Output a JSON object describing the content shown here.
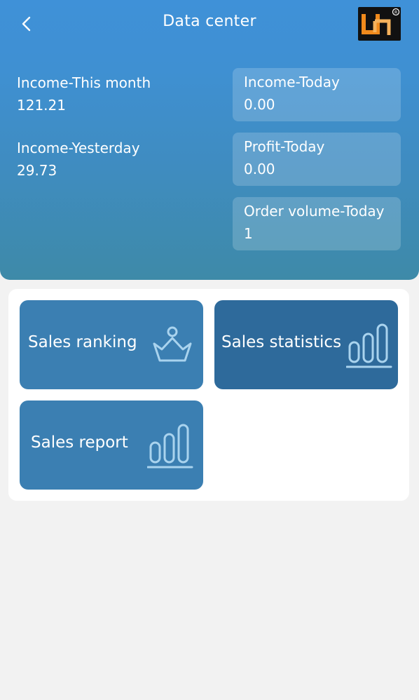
{
  "header": {
    "title": "Data center"
  },
  "stats": {
    "income_month": {
      "label": "Income-This month",
      "value": "121.21"
    },
    "income_yesterday": {
      "label": "Income-Yesterday",
      "value": "29.73"
    },
    "income_today": {
      "label": "Income-Today",
      "value": "0.00"
    },
    "profit_today": {
      "label": "Profit-Today",
      "value": "0.00"
    },
    "orders_today": {
      "label": "Order volume-Today",
      "value": "1"
    }
  },
  "menu": {
    "ranking": {
      "label": "Sales ranking",
      "icon": "crown-icon"
    },
    "statistics": {
      "label": "Sales statistics",
      "icon": "bar-chart-icon"
    },
    "report": {
      "label": "Sales report",
      "icon": "bar-chart-icon"
    }
  },
  "colors": {
    "header_top": "#3f91d8",
    "header_bottom": "#3e8aa8",
    "tile": "#3b7fb2",
    "tile_active": "#2e6a9b",
    "background": "#f2f2f2",
    "logo_bg": "#111111",
    "logo_accent": "#f08a1c"
  }
}
